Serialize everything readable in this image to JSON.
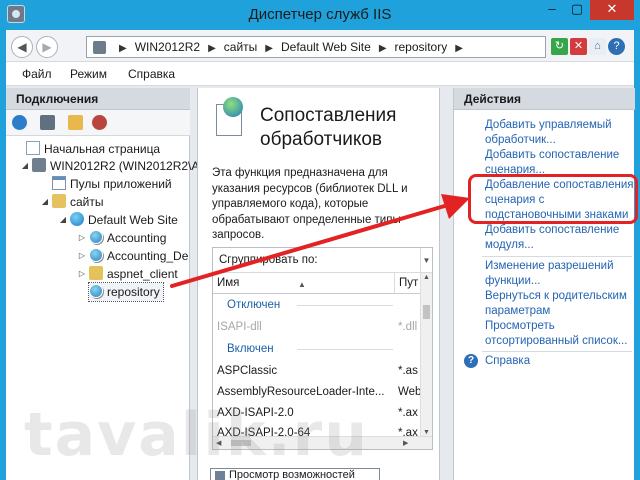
{
  "window": {
    "title": "Диспетчер служб IIS",
    "controls": {
      "minimize": "–",
      "maximize": "▢",
      "close": "✕"
    }
  },
  "addressbar": {
    "crumbs": [
      "WIN2012R2",
      "сайты",
      "Default Web Site",
      "repository"
    ],
    "nav_back": "◀",
    "nav_forward": "▶"
  },
  "menubar": {
    "items": [
      "Файл",
      "Режим",
      "Справка"
    ]
  },
  "connections": {
    "header": "Подключения",
    "tree": [
      {
        "label": "Начальная страница",
        "icon": "start-page-icon"
      },
      {
        "label": "WIN2012R2 (WIN2012R2\\A",
        "icon": "server-icon"
      },
      {
        "label": "Пулы приложений",
        "icon": "app-pools-icon"
      },
      {
        "label": "сайты",
        "icon": "sites-folder-icon"
      },
      {
        "label": "Default Web Site",
        "icon": "globe-icon"
      },
      {
        "label": "Accounting",
        "icon": "web-app-icon"
      },
      {
        "label": "Accounting_De",
        "icon": "web-app-icon"
      },
      {
        "label": "aspnet_client",
        "icon": "folder-icon"
      },
      {
        "label": "repository",
        "icon": "web-app-icon"
      }
    ]
  },
  "feature": {
    "title": "Сопоставления обработчиков",
    "description": "Эта функция предназначена для указания ресурсов (библиотек DLL и управляемого кода), которые обрабатывают определенные типы запросов.",
    "group_by_label": "Сгруппировать по:",
    "columns": [
      "Имя",
      "Пут"
    ],
    "rows": [
      {
        "type": "group",
        "name": "Отключен",
        "path": ""
      },
      {
        "type": "row",
        "name": "ISAPI-dll",
        "path": "*.dll",
        "disabled": true
      },
      {
        "type": "group",
        "name": "Включен",
        "path": ""
      },
      {
        "type": "row",
        "name": "ASPClassic",
        "path": "*.as"
      },
      {
        "type": "row",
        "name": "AssemblyResourceLoader-Inte...",
        "path": "Web"
      },
      {
        "type": "row",
        "name": "AXD-ISAPI-2.0",
        "path": "*.ax"
      },
      {
        "type": "row",
        "name": "AXD-ISAPI-2.0-64",
        "path": "*.ax"
      }
    ],
    "view_tab": "Просмотр возможностей"
  },
  "actions": {
    "header": "Действия",
    "items": [
      "Добавить управляемый обработчик...",
      "Добавить сопоставление сценария...",
      "Добавление сопоставления сценария с подстановочными знаками",
      "Добавить сопоставление модуля...",
      "Изменение разрешений функции...",
      "Вернуться к родительским параметрам",
      "Просмотреть отсортированный список...",
      "Справка"
    ]
  },
  "annotation": {
    "color": "#e32323"
  },
  "watermark": "tavalik.ru"
}
